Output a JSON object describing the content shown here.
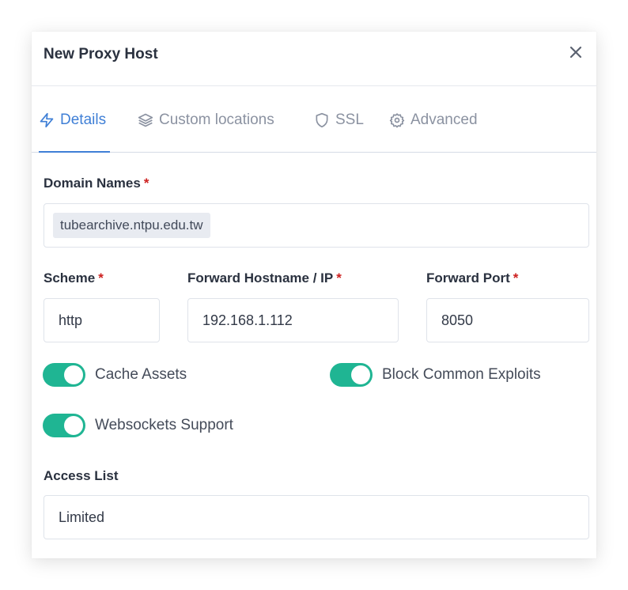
{
  "modal": {
    "title": "New Proxy Host",
    "close_icon": "close-icon"
  },
  "tabs": [
    {
      "label": "Details",
      "icon": "bolt-icon",
      "active": true
    },
    {
      "label": "Custom locations",
      "icon": "layers-icon",
      "active": false
    },
    {
      "label": "SSL",
      "icon": "shield-icon",
      "active": false
    },
    {
      "label": "Advanced",
      "icon": "gear-icon",
      "active": false
    }
  ],
  "form": {
    "required_mark": "*",
    "domain_names": {
      "label": "Domain Names",
      "value": "tubearchive.ntpu.edu.tw"
    },
    "scheme": {
      "label": "Scheme",
      "value": "http"
    },
    "forward_host": {
      "label": "Forward Hostname / IP",
      "value": "192.168.1.112"
    },
    "forward_port": {
      "label": "Forward Port",
      "value": "8050"
    },
    "cache_assets": {
      "label": "Cache Assets",
      "on": true
    },
    "block_exploits": {
      "label": "Block Common Exploits",
      "on": true
    },
    "websockets": {
      "label": "Websockets Support",
      "on": true
    },
    "access_list": {
      "label": "Access List",
      "value": "Limited"
    }
  },
  "colors": {
    "accent": "#3f7fd6",
    "toggle_on": "#1fb593",
    "required": "#cd201f",
    "tab_inactive": "#8b92a1"
  }
}
